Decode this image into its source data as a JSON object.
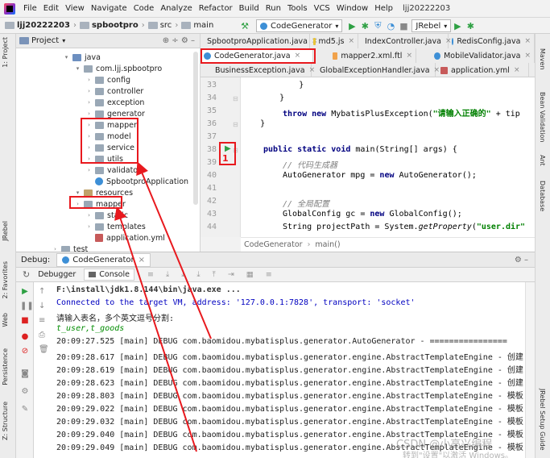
{
  "menu": {
    "items": [
      "File",
      "Edit",
      "View",
      "Navigate",
      "Code",
      "Analyze",
      "Refactor",
      "Build",
      "Run",
      "Tools",
      "VCS",
      "Window",
      "Help"
    ],
    "project_name": "ljj20222203"
  },
  "breadcrumb": [
    "ljj20222203",
    "spbootpro",
    "src",
    "main"
  ],
  "toolbar": {
    "run_config": "CodeGenerator",
    "jrebel": "JRebel"
  },
  "left_stripe": {
    "project": "1: Project",
    "rebel": "JRebel",
    "favorites": "2: Favorites",
    "web": "Web",
    "persistence": "Persistence",
    "structure": "Z: Structure"
  },
  "right_stripe": {
    "maven": "Maven",
    "bean_validation": "Bean Validation",
    "ant": "Ant",
    "database": "Database",
    "jrebel_setup": "JRebel Setup Guide"
  },
  "project_panel": {
    "title": "Project",
    "tree": [
      {
        "label": "java",
        "icon": "folder-blue"
      },
      {
        "label": "com.ljj.spbootpro",
        "icon": "package"
      },
      {
        "label": "config",
        "icon": "package"
      },
      {
        "label": "controller",
        "icon": "package"
      },
      {
        "label": "exception",
        "icon": "package"
      },
      {
        "label": "generator",
        "icon": "package"
      },
      {
        "label": "mapper",
        "icon": "package"
      },
      {
        "label": "model",
        "icon": "package"
      },
      {
        "label": "service",
        "icon": "package"
      },
      {
        "label": "utils",
        "icon": "package"
      },
      {
        "label": "validator",
        "icon": "package"
      },
      {
        "label": "SpbootproApplication",
        "icon": "class"
      },
      {
        "label": "resources",
        "icon": "folder-res"
      },
      {
        "label": "mapper",
        "icon": "folder"
      },
      {
        "label": "static",
        "icon": "folder"
      },
      {
        "label": "templates",
        "icon": "folder"
      },
      {
        "label": "application.yml",
        "icon": "yml"
      },
      {
        "label": "test",
        "icon": "folder"
      }
    ]
  },
  "editor": {
    "tabs_row1": [
      "SpbootproApplication.java",
      "md5.js",
      "IndexController.java",
      "RedisConfig.java"
    ],
    "tabs_row2": [
      "CodeGenerator.java",
      "mapper2.xml.ftl",
      "MobileValidator.java"
    ],
    "tabs_row3": [
      "BusinessException.java",
      "GlobalExceptionHandler.java",
      "application.yml"
    ],
    "line_numbers": [
      "33",
      "34",
      "35",
      "36",
      "37",
      "38",
      "39",
      "40",
      "41",
      "42",
      "43",
      "44"
    ],
    "code": {
      "l33": "            }",
      "l34": "        }",
      "l35_kw1": "throw",
      "l35_kw2": "new",
      "l35_a": " MybatisPlusException(",
      "l35_str": "\"请输入正确的\"",
      "l35_b": " + tip",
      "l36": "    }",
      "l38_kw": "public static void",
      "l38_b": " main(String[] args) {",
      "l39": "// 代码生成器",
      "l40_a": "AutoGenerator mpg = ",
      "l40_kw": "new",
      "l40_b": " AutoGenerator();",
      "l42": "// 全局配置",
      "l43_a": "GlobalConfig gc = ",
      "l43_kw": "new",
      "l43_b": " GlobalConfig();",
      "l44_a": "String projectPath = System.",
      "l44_it": "getProperty",
      "l44_b": "(",
      "l44_str": "\"user.dir\""
    },
    "crumb": [
      "CodeGenerator",
      "main()"
    ]
  },
  "debug": {
    "label": "Debug:",
    "config": "CodeGenerator",
    "tab_debugger": "Debugger",
    "tab_console": "Console",
    "lines": [
      {
        "text": "F:\\install\\jdk1.8.144\\bin\\java.exe ...",
        "style": "bold"
      },
      {
        "text": "Connected to the target VM, address: '127.0.0.1:7828', transport: 'socket'",
        "style": "blue"
      },
      {
        "text": "请输入表名，多个英文逗号分割:",
        "style": "normal"
      },
      {
        "text": "t_user,t_goods",
        "style": "green"
      },
      {
        "text": "20:09:27.525 [main] DEBUG com.baomidou.mybatisplus.generator.AutoGenerator - ================",
        "style": "normal"
      },
      {
        "text": "20:09:28.617 [main] DEBUG com.baomidou.mybatisplus.generator.engine.AbstractTemplateEngine - 创建",
        "style": "normal"
      },
      {
        "text": "20:09:28.619 [main] DEBUG com.baomidou.mybatisplus.generator.engine.AbstractTemplateEngine - 创建",
        "style": "normal"
      },
      {
        "text": "20:09:28.623 [main] DEBUG com.baomidou.mybatisplus.generator.engine.AbstractTemplateEngine - 创建",
        "style": "normal"
      },
      {
        "text": "20:09:28.803 [main] DEBUG com.baomidou.mybatisplus.generator.engine.AbstractTemplateEngine - 模板",
        "style": "normal"
      },
      {
        "text": "20:09:29.022 [main] DEBUG com.baomidou.mybatisplus.generator.engine.AbstractTemplateEngine - 模板",
        "style": "normal"
      },
      {
        "text": "20:09:29.032 [main] DEBUG com.baomidou.mybatisplus.generator.engine.AbstractTemplateEngine - 模板",
        "style": "normal"
      },
      {
        "text": "20:09:29.040 [main] DEBUG com.baomidou.mybatisplus.generator.engine.AbstractTemplateEngine - 模板",
        "style": "normal"
      },
      {
        "text": "20:09:29.049 [main] DEBUG com.baomidou.mybatisplus.generator.engine.AbstractTemplateEngine - 模板",
        "style": "normal"
      }
    ]
  },
  "annotation": {
    "marker": "1"
  },
  "watermark": {
    "line1": "CSDN @小高兴编程",
    "line2": "转到\"设置\"以激活 Windows。"
  },
  "colors": {
    "annotation_red": "#e8191e",
    "run_green": "#2ea043"
  }
}
